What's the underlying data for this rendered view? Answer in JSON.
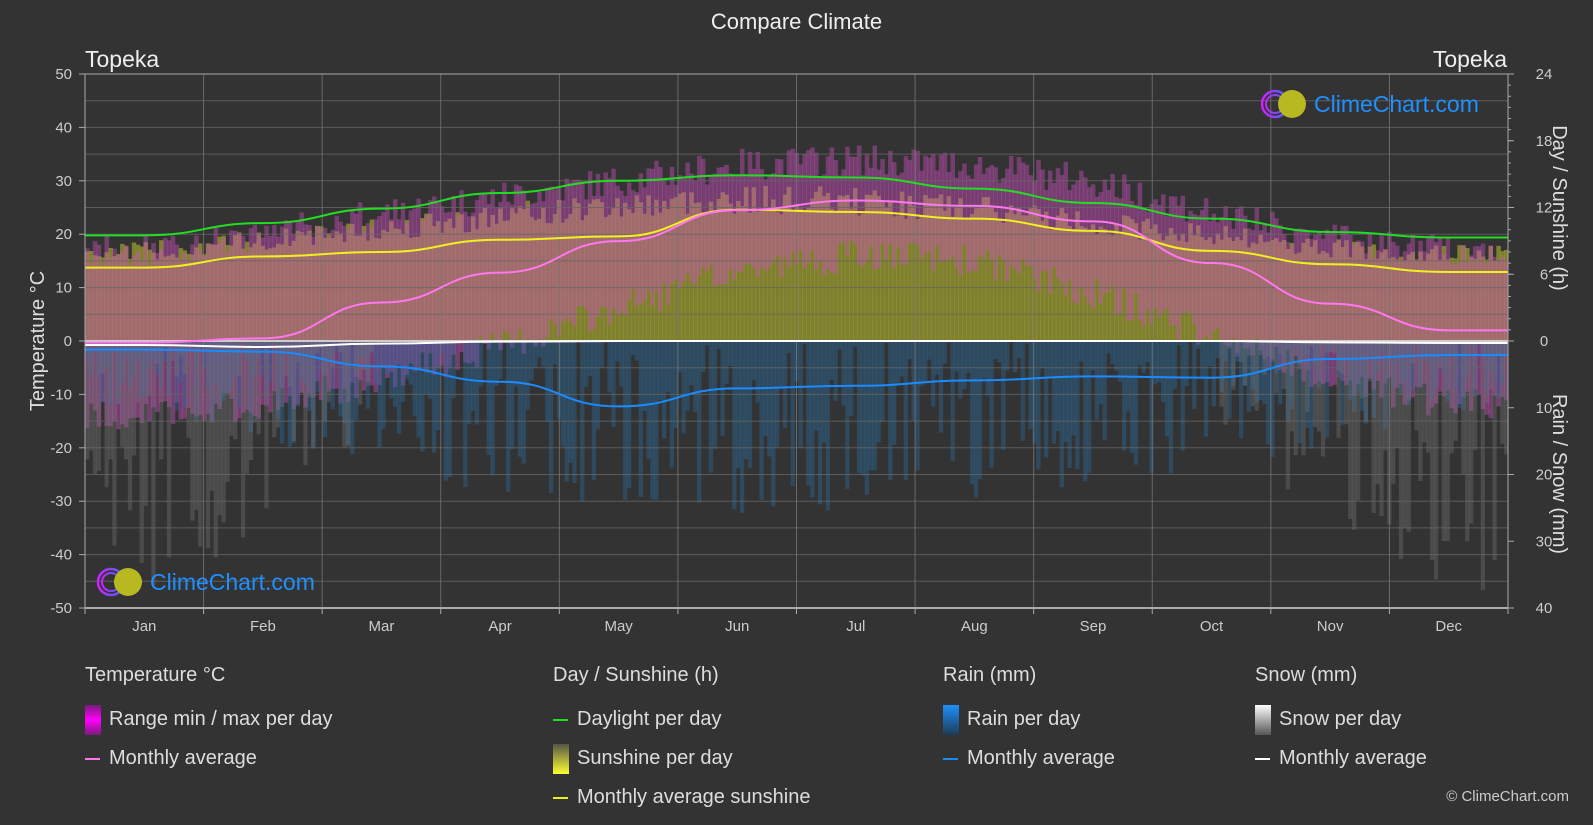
{
  "title": "Compare Climate",
  "location_left": "Topeka",
  "location_right": "Topeka",
  "logo_text": "ClimeChart.com",
  "copyright": "© ClimeChart.com",
  "colors": {
    "background": "#333333",
    "grid": "#5a5a5a",
    "temp_range": "#e000e0",
    "temp_avg": "#ff77ee",
    "daylight": "#22dd22",
    "sunshine_fill": "#a8a830",
    "sunshine_avg": "#f0f020",
    "rain": "#1e90ff",
    "rain_avg": "#1a8cff",
    "snow": "#cccccc",
    "snow_avg": "#ffffff",
    "logo_text": "#1e90ff"
  },
  "legend": {
    "groups": [
      {
        "title": "Temperature °C",
        "items": [
          {
            "label": "Range min / max per day",
            "type": "bar",
            "key": "temp_range"
          },
          {
            "label": "Monthly average",
            "type": "line",
            "key": "temp_avg"
          }
        ]
      },
      {
        "title": "Day / Sunshine (h)",
        "items": [
          {
            "label": "Daylight per day",
            "type": "line",
            "key": "daylight"
          },
          {
            "label": "Sunshine per day",
            "type": "bar",
            "key": "sunshine_fill"
          },
          {
            "label": "Monthly average sunshine",
            "type": "line",
            "key": "sunshine_avg"
          }
        ]
      },
      {
        "title": "Rain (mm)",
        "items": [
          {
            "label": "Rain per day",
            "type": "bar",
            "key": "rain"
          },
          {
            "label": "Monthly average",
            "type": "line",
            "key": "rain_avg"
          }
        ]
      },
      {
        "title": "Snow (mm)",
        "items": [
          {
            "label": "Snow per day",
            "type": "bar",
            "key": "snow"
          },
          {
            "label": "Monthly average",
            "type": "line",
            "key": "snow_avg"
          }
        ]
      }
    ]
  },
  "chart_data": {
    "type": "line",
    "title": "Compare Climate",
    "categories": [
      "Jan",
      "Feb",
      "Mar",
      "Apr",
      "May",
      "Jun",
      "Jul",
      "Aug",
      "Sep",
      "Oct",
      "Nov",
      "Dec"
    ],
    "y_left": {
      "label": "Temperature °C",
      "range": [
        -50,
        50
      ],
      "ticks": [
        50,
        40,
        30,
        20,
        10,
        0,
        -10,
        -20,
        -30,
        -40,
        -50
      ]
    },
    "y_right_top": {
      "label": "Day / Sunshine (h)",
      "range": [
        0,
        24
      ],
      "ticks": [
        24,
        18,
        12,
        6,
        0
      ]
    },
    "y_right_bottom": {
      "label": "Rain / Snow (mm)",
      "range": [
        0,
        40
      ],
      "ticks": [
        0,
        10,
        20,
        30,
        40
      ]
    },
    "grid": true,
    "series": [
      {
        "name": "Temperature monthly average (°C)",
        "axis": "temp",
        "values": [
          -0.3,
          0.5,
          7.2,
          12.8,
          18.7,
          24.5,
          26.3,
          25.3,
          22.4,
          14.6,
          7.0,
          2.0
        ]
      },
      {
        "name": "Temperature daily max envelope (°C)",
        "axis": "temp",
        "values": [
          17,
          20,
          24,
          27,
          30,
          33,
          34,
          33,
          30,
          24,
          19,
          17
        ]
      },
      {
        "name": "Temperature daily min envelope (°C)",
        "axis": "temp",
        "values": [
          -14,
          -12,
          -7,
          -1,
          6,
          13,
          16,
          15,
          9,
          1,
          -7,
          -12
        ]
      },
      {
        "name": "Daylight per day (h)",
        "axis": "sun",
        "values": [
          9.5,
          10.6,
          11.9,
          13.3,
          14.4,
          14.9,
          14.7,
          13.7,
          12.4,
          11.0,
          9.8,
          9.3
        ]
      },
      {
        "name": "Sunshine per day (h)",
        "axis": "sun",
        "values": [
          8.5,
          9.5,
          10.6,
          11.8,
          12.8,
          13.4,
          13.2,
          12.5,
          11.2,
          10.0,
          8.8,
          8.3
        ]
      },
      {
        "name": "Monthly average sunshine (h)",
        "axis": "sun",
        "values": [
          6.6,
          7.6,
          8.0,
          9.1,
          9.4,
          11.8,
          11.6,
          11.0,
          9.9,
          8.1,
          6.9,
          6.2
        ]
      },
      {
        "name": "Rain monthly average (mm)",
        "axis": "precip",
        "values": [
          1.3,
          1.6,
          3.8,
          6.1,
          9.8,
          7.1,
          6.7,
          5.9,
          5.3,
          5.5,
          2.7,
          2.1
        ]
      },
      {
        "name": "Snow monthly average (mm)",
        "axis": "precip",
        "values": [
          0.6,
          0.9,
          0.4,
          0.1,
          0.0,
          0.0,
          0.0,
          0.0,
          0.0,
          0.0,
          0.2,
          0.3
        ]
      }
    ]
  }
}
